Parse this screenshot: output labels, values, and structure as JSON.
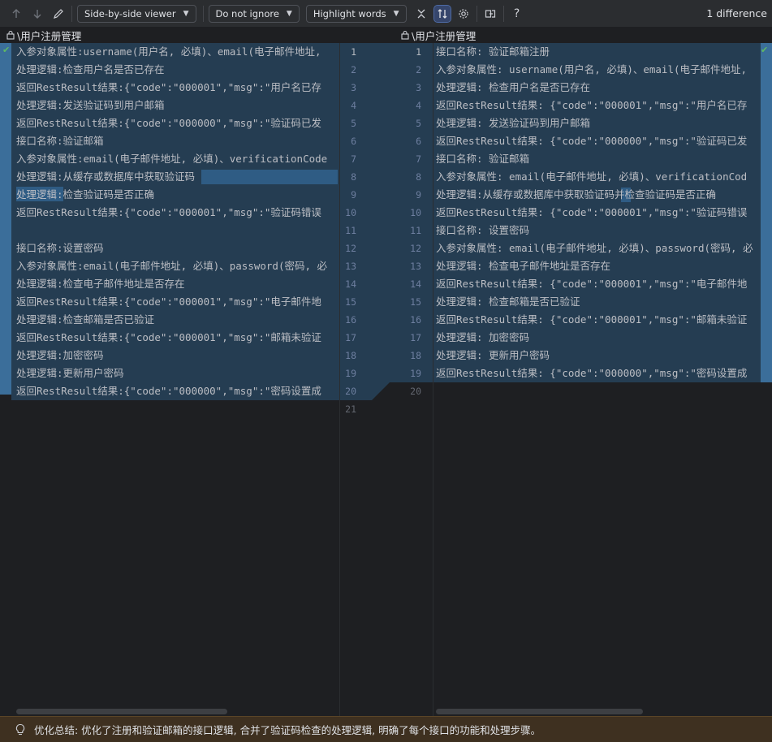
{
  "toolbar": {
    "viewer_mode": "Side-by-side viewer",
    "whitespace_mode": "Do not ignore",
    "highlight_mode": "Highlight words",
    "help_label": "?",
    "difference_count": "1 difference",
    "icons": [
      "arrow-up-icon",
      "arrow-down-icon",
      "pencil-icon",
      "collapse-icon",
      "sync-scroll-icon",
      "settings-icon",
      "compare-icon",
      "help-icon"
    ]
  },
  "left_file": {
    "title": "\\用户注册管理",
    "lines": [
      "入参对象属性:username(用户名, 必填)、email(电子邮件地址,",
      "处理逻辑:检查用户名是否已存在",
      "返回RestResult结果:{\"code\":\"000001\",\"msg\":\"用户名已存",
      "处理逻辑:发送验证码到用户邮箱",
      "返回RestResult结果:{\"code\":\"000000\",\"msg\":\"验证码已发",
      "接口名称:验证邮箱",
      "入参对象属性:email(电子邮件地址, 必填)、verificationCode",
      "处理逻辑:从缓存或数据库中获取验证码",
      "处理逻辑:检查验证码是否正确",
      "返回RestResult结果:{\"code\":\"000001\",\"msg\":\"验证码错误",
      "",
      "接口名称:设置密码",
      "入参对象属性:email(电子邮件地址, 必填)、password(密码, 必",
      "处理逻辑:检查电子邮件地址是否存在",
      "返回RestResult结果:{\"code\":\"000001\",\"msg\":\"电子邮件地",
      "处理逻辑:检查邮箱是否已验证",
      "返回RestResult结果:{\"code\":\"000001\",\"msg\":\"邮箱未验证",
      "处理逻辑:加密密码",
      "处理逻辑:更新用户密码",
      "返回RestResult结果:{\"code\":\"000000\",\"msg\":\"密码设置成"
    ]
  },
  "right_file": {
    "title": "\\用户注册管理",
    "lines": [
      "接口名称: 验证邮箱注册",
      "入参对象属性: username(用户名, 必填)、email(电子邮件地址,",
      "处理逻辑: 检查用户名是否已存在",
      "返回RestResult结果: {\"code\":\"000001\",\"msg\":\"用户名已存",
      "处理逻辑: 发送验证码到用户邮箱",
      "返回RestResult结果: {\"code\":\"000000\",\"msg\":\"验证码已发",
      "接口名称: 验证邮箱",
      "入参对象属性: email(电子邮件地址, 必填)、verificationCod",
      "处理逻辑:从缓存或数据库中获取验证码并检查验证码是否正确",
      "返回RestResult结果: {\"code\":\"000001\",\"msg\":\"验证码错误",
      "接口名称: 设置密码",
      "入参对象属性: email(电子邮件地址, 必填)、password(密码, 必",
      "处理逻辑: 检查电子邮件地址是否存在",
      "返回RestResult结果: {\"code\":\"000001\",\"msg\":\"电子邮件地",
      "处理逻辑: 检查邮箱是否已验证",
      "返回RestResult结果: {\"code\":\"000001\",\"msg\":\"邮箱未验证",
      "处理逻辑: 加密密码",
      "处理逻辑: 更新用户密码",
      "返回RestResult结果: {\"code\":\"000000\",\"msg\":\"密码设置成"
    ]
  },
  "gutter": {
    "left_numbers": [
      "1",
      "2",
      "3",
      "4",
      "5",
      "6",
      "7",
      "8",
      "9",
      "10",
      "11",
      "12",
      "13",
      "14",
      "15",
      "16",
      "17",
      "18",
      "19",
      "20",
      "21"
    ],
    "right_numbers": [
      "1",
      "2",
      "3",
      "4",
      "5",
      "6",
      "7",
      "8",
      "9",
      "10",
      "11",
      "12",
      "13",
      "14",
      "15",
      "16",
      "17",
      "18",
      "19",
      "20"
    ]
  },
  "footer": {
    "summary": "优化总结: 优化了注册和验证邮箱的接口逻辑, 合并了验证码检查的处理逻辑, 明确了每个接口的功能和处理步骤。"
  },
  "colors": {
    "background": "#1e1f22",
    "toolbar": "#2b2d30",
    "changed_block": "#253d52",
    "word_highlight": "#2f5c84",
    "stripe": "#3b6e9a",
    "footer": "#3e3020"
  }
}
